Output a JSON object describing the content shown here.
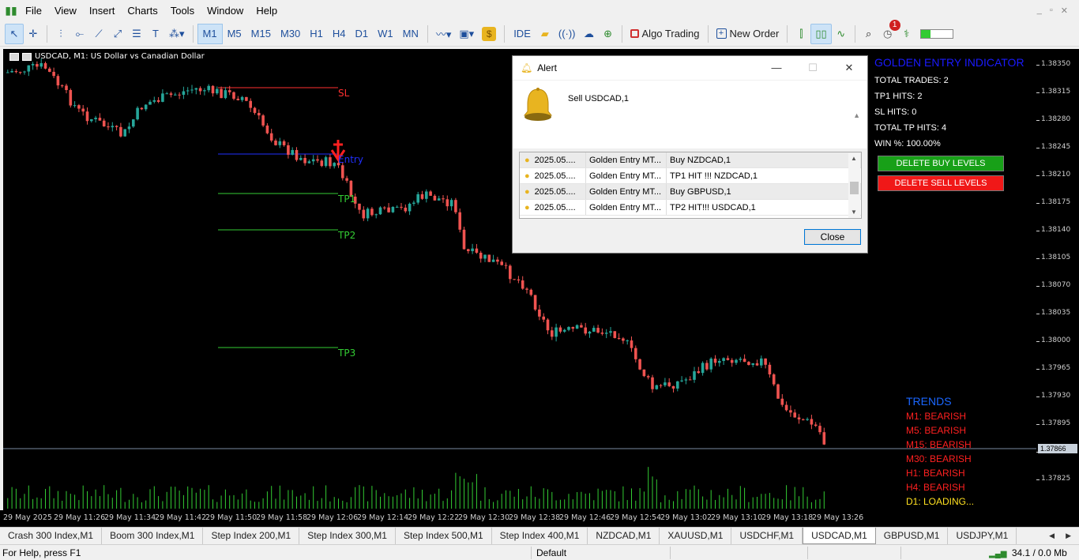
{
  "menu": [
    "File",
    "View",
    "Insert",
    "Charts",
    "Tools",
    "Window",
    "Help"
  ],
  "toolbar": {
    "timeframes": [
      "M1",
      "M5",
      "M15",
      "M30",
      "H1",
      "H4",
      "D1",
      "W1",
      "MN"
    ],
    "active_timeframe": "M1",
    "ide_label": "IDE",
    "algo_label": "Algo Trading",
    "new_order_label": "New Order",
    "notification_count": "1"
  },
  "chart": {
    "title": "USDCAD, M1:  US Dollar vs Canadian Dollar",
    "current_price": "1.37866",
    "price_axis": [
      "1.38350",
      "1.38315",
      "1.38280",
      "1.38245",
      "1.38210",
      "1.38175",
      "1.38140",
      "1.38105",
      "1.38070",
      "1.38035",
      "1.38000",
      "1.37965",
      "1.37930",
      "1.37895",
      "1.37860",
      "1.37825"
    ],
    "time_axis": [
      "29 May 2025",
      "29 May 11:26",
      "29 May 11:34",
      "29 May 11:42",
      "29 May 11:50",
      "29 May 11:58",
      "29 May 12:06",
      "29 May 12:14",
      "29 May 12:22",
      "29 May 12:30",
      "29 May 12:38",
      "29 May 12:46",
      "29 May 12:54",
      "29 May 13:02",
      "29 May 13:10",
      "29 May 13:18",
      "29 May 13:26"
    ],
    "levels": {
      "sl": "SL",
      "entry": "Entry",
      "tp1": "TP1",
      "tp2": "TP2",
      "tp3": "TP3"
    },
    "colors": {
      "bull": "#26a69a",
      "bear": "#ef5350",
      "volume": "#33cc33",
      "sl_line": "#ff3030",
      "entry_line": "#2030ff",
      "tp_line": "#33cc33",
      "sell_arrow": "#ff2020"
    }
  },
  "indicator": {
    "title": "GOLDEN ENTRY INDICATOR",
    "stats": [
      "TOTAL TRADES: 2",
      "TP1 HITS: 2",
      "SL HITS: 0",
      "TOTAL TP HITS: 4",
      "WIN %: 100.00%"
    ],
    "delete_buy_label": "DELETE BUY LEVELS",
    "delete_sell_label": "DELETE SELL LEVELS"
  },
  "trends": {
    "title": "TRENDS",
    "rows": [
      {
        "label": "M1: BEARISH",
        "color": "#ff2020"
      },
      {
        "label": "M5: BEARISH",
        "color": "#ff2020"
      },
      {
        "label": "M15: BEARISH",
        "color": "#ff2020"
      },
      {
        "label": "M30: BEARISH",
        "color": "#ff2020"
      },
      {
        "label": "H1: BEARISH",
        "color": "#ff2020"
      },
      {
        "label": "H4: BEARISH",
        "color": "#ff2020"
      },
      {
        "label": "D1: LOADING...",
        "color": "#ffe020"
      }
    ]
  },
  "alert": {
    "title": "Alert",
    "message": "Sell USDCAD,1",
    "rows": [
      {
        "time": "2025.05....",
        "source": "Golden Entry MT...",
        "text": "Buy NZDCAD,1"
      },
      {
        "time": "2025.05....",
        "source": "Golden Entry MT...",
        "text": "TP1 HIT !!! NZDCAD,1"
      },
      {
        "time": "2025.05....",
        "source": "Golden Entry MT...",
        "text": "Buy GBPUSD,1"
      },
      {
        "time": "2025.05....",
        "source": "Golden Entry MT...",
        "text": "TP2 HIT!!! USDCAD,1"
      }
    ],
    "close_label": "Close"
  },
  "tabs": [
    "Crash 300 Index,M1",
    "Boom 300 Index,M1",
    "Step Index 200,M1",
    "Step Index 300,M1",
    "Step Index 500,M1",
    "Step Index 400,M1",
    "NZDCAD,M1",
    "XAUUSD,M1",
    "USDCHF,M1",
    "USDCAD,M1",
    "GBPUSD,M1",
    "USDJPY,M1"
  ],
  "active_tab": "USDCAD,M1",
  "status": {
    "help": "For Help, press F1",
    "profile": "Default",
    "network": "34.1 / 0.0 Mb"
  }
}
